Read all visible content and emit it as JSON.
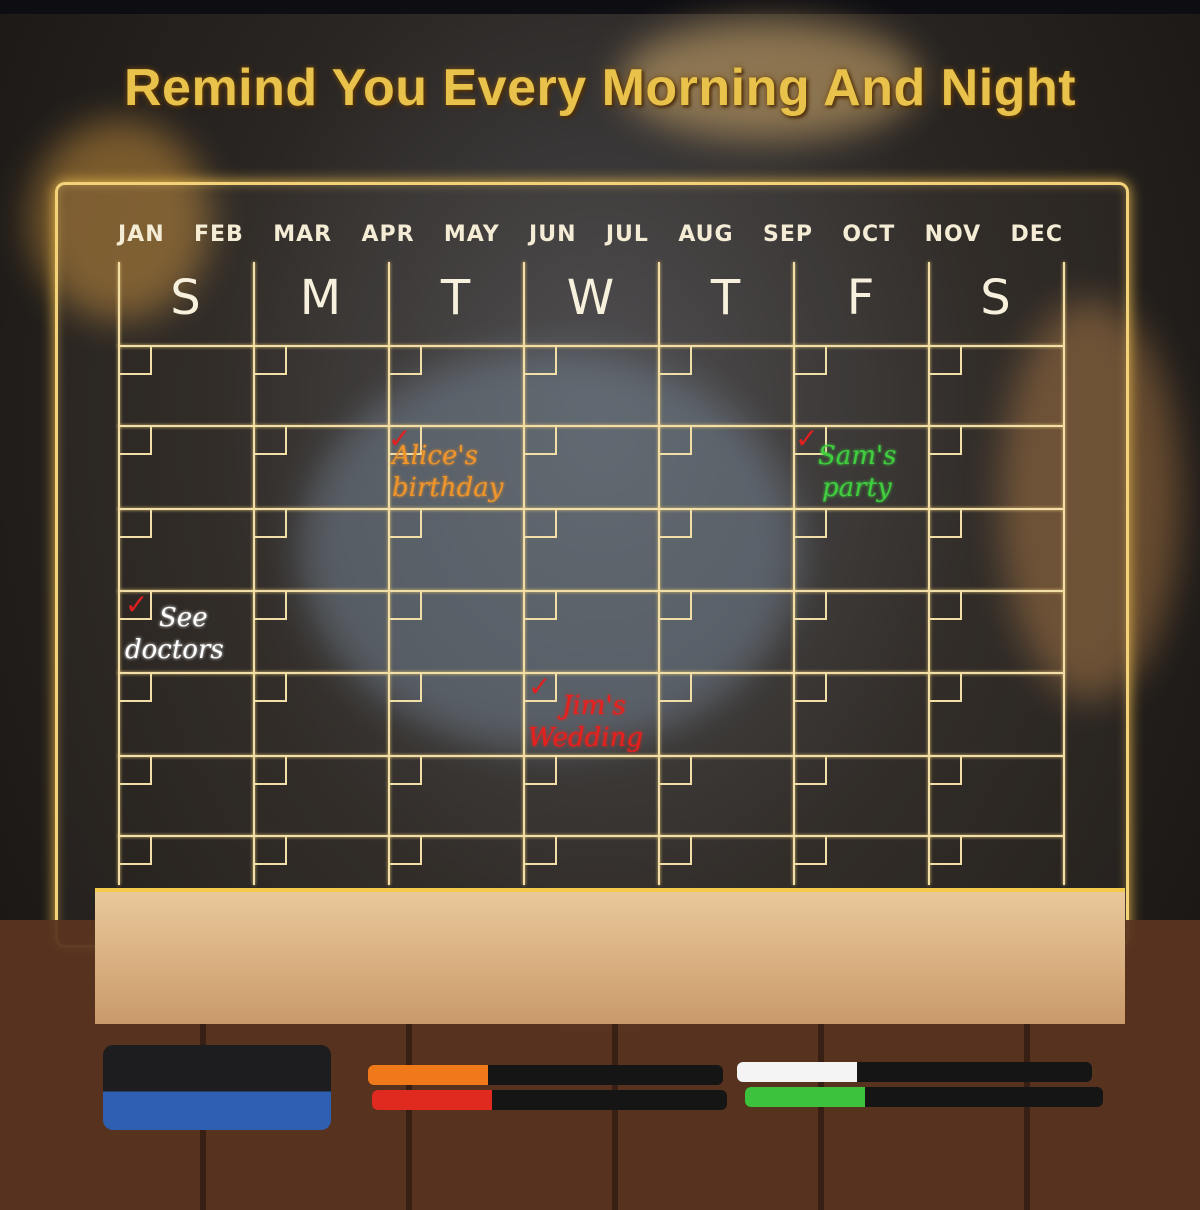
{
  "headline": "Remind You Every Morning And Night",
  "calendar": {
    "months": [
      "JAN",
      "FEB",
      "MAR",
      "APR",
      "MAY",
      "JUN",
      "JUL",
      "AUG",
      "SEP",
      "OCT",
      "NOV",
      "DEC"
    ],
    "weekdays": [
      "S",
      "M",
      "T",
      "W",
      "T",
      "F",
      "S"
    ],
    "notes": [
      {
        "line1": "Alice's",
        "line2": "birthday",
        "color": "#f0952a"
      },
      {
        "line1": "Sam's",
        "line2": "party",
        "color": "#3fcf3f"
      },
      {
        "line1": "See",
        "line2": "doctors",
        "color": "#ffffff"
      },
      {
        "line1": "Jim's",
        "line2": "Wedding",
        "color": "#e8201c"
      }
    ]
  },
  "accessories": {
    "marker_colors": [
      "#f07a1a",
      "#e02a20",
      "#f4f4f4",
      "#3cc23c"
    ],
    "eraser_colors": [
      "#1d1d1f",
      "#2f5fb0"
    ]
  }
}
